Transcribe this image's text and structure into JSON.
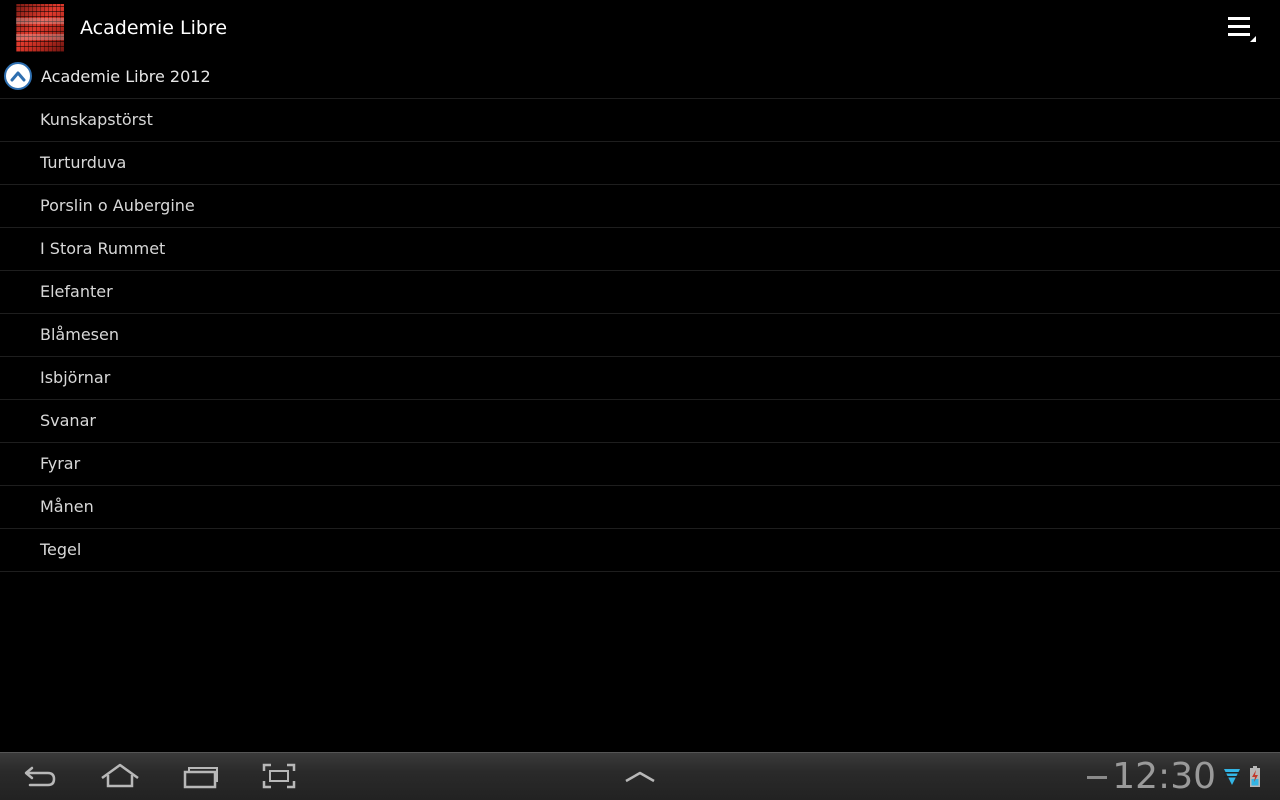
{
  "app": {
    "title": "Academie Libre"
  },
  "group": {
    "title": "Academie Libre 2012",
    "expanded": true
  },
  "items": [
    "Kunskapstörst",
    "Turturduva",
    "Porslin o Aubergine",
    "I Stora Rummet",
    "Elefanter",
    "Blåmesen",
    "Isbjörnar",
    "Svanar",
    "Fyrar",
    "Månen",
    "Tegel"
  ],
  "status": {
    "time": "12:30"
  },
  "icons": {
    "logo": "app-logo-icon",
    "overflow": "overflow-menu-icon",
    "collapse": "chevron-up-icon",
    "back": "back-icon",
    "home": "home-icon",
    "recent": "recent-apps-icon",
    "screenshot": "screenshot-icon",
    "up": "chevron-up-icon",
    "wifi": "wifi-icon",
    "battery": "battery-icon"
  },
  "colors": {
    "background": "#000000",
    "accent": "#2e6fb0",
    "text": "#d8d8d8",
    "wifi": "#33b5e5"
  }
}
